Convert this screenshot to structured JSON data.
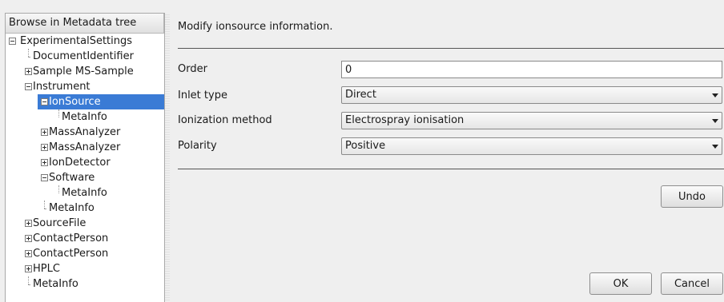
{
  "tree": {
    "header": "Browse in Metadata tree",
    "items": [
      {
        "label": "ExperimentalSettings",
        "name": "tree-item-experimental-settings"
      },
      {
        "label": "DocumentIdentifier",
        "name": "tree-item-document-identifier"
      },
      {
        "label": "Sample MS-Sample",
        "name": "tree-item-sample"
      },
      {
        "label": "Instrument",
        "name": "tree-item-instrument"
      },
      {
        "label": "IonSource",
        "name": "tree-item-ionsource"
      },
      {
        "label": "MetaInfo",
        "name": "tree-item-ionsource-metainfo"
      },
      {
        "label": "MassAnalyzer",
        "name": "tree-item-massanalyzer-1"
      },
      {
        "label": "MassAnalyzer",
        "name": "tree-item-massanalyzer-2"
      },
      {
        "label": "IonDetector",
        "name": "tree-item-iondetector"
      },
      {
        "label": "Software",
        "name": "tree-item-software"
      },
      {
        "label": "MetaInfo",
        "name": "tree-item-software-metainfo"
      },
      {
        "label": "MetaInfo",
        "name": "tree-item-instrument-metainfo"
      },
      {
        "label": "SourceFile",
        "name": "tree-item-sourcefile"
      },
      {
        "label": "ContactPerson",
        "name": "tree-item-contactperson-1"
      },
      {
        "label": "ContactPerson",
        "name": "tree-item-contactperson-2"
      },
      {
        "label": "HPLC",
        "name": "tree-item-hplc"
      },
      {
        "label": "MetaInfo",
        "name": "tree-item-metainfo"
      }
    ]
  },
  "form": {
    "title": "Modify ionsource information.",
    "order_label": "Order",
    "order_value": "0",
    "inlet_label": "Inlet type",
    "inlet_value": "Direct",
    "ionization_label": "Ionization method",
    "ionization_value": "Electrospray ionisation",
    "polarity_label": "Polarity",
    "polarity_value": "Positive"
  },
  "buttons": {
    "undo": "Undo",
    "ok": "OK",
    "cancel": "Cancel"
  },
  "colors": {
    "selection": "#3a7bd5",
    "background": "#efefef"
  }
}
